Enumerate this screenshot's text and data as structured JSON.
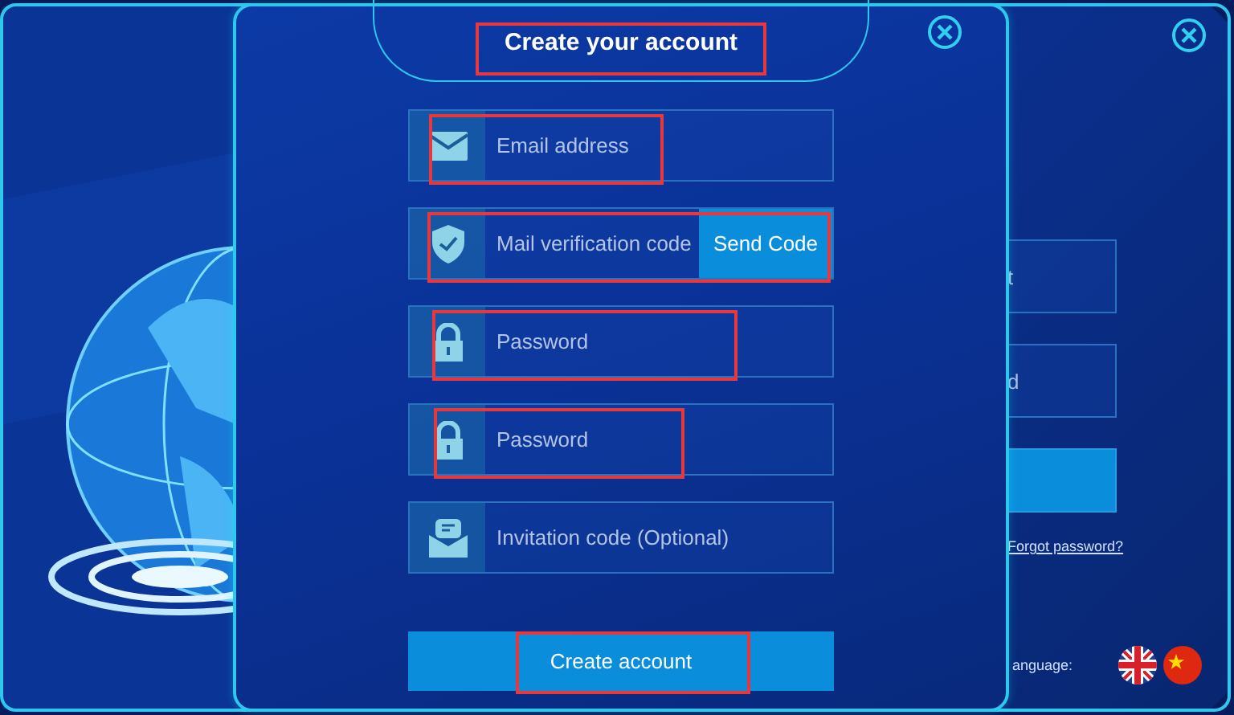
{
  "back_window": {
    "fields": [
      {
        "placeholder": "t"
      },
      {
        "placeholder": "d"
      }
    ],
    "forgot_link": "Forgot password?",
    "language_label": "anguage:",
    "languages": [
      {
        "kind": "uk"
      },
      {
        "kind": "cn"
      }
    ]
  },
  "dialog": {
    "title": "Create your account",
    "title_highlighted": true,
    "fields": [
      {
        "kind": "email",
        "placeholder": "Email address",
        "highlighted": true
      },
      {
        "kind": "code",
        "placeholder": "Mail verification code",
        "button": "Send Code",
        "highlighted": true
      },
      {
        "kind": "password",
        "placeholder": "Password",
        "highlighted": true
      },
      {
        "kind": "password",
        "placeholder": "Password",
        "highlighted": true
      },
      {
        "kind": "invite",
        "placeholder": "Invitation code (Optional)",
        "highlighted": false
      }
    ],
    "submit": {
      "label": "Create account",
      "highlighted": true
    }
  }
}
